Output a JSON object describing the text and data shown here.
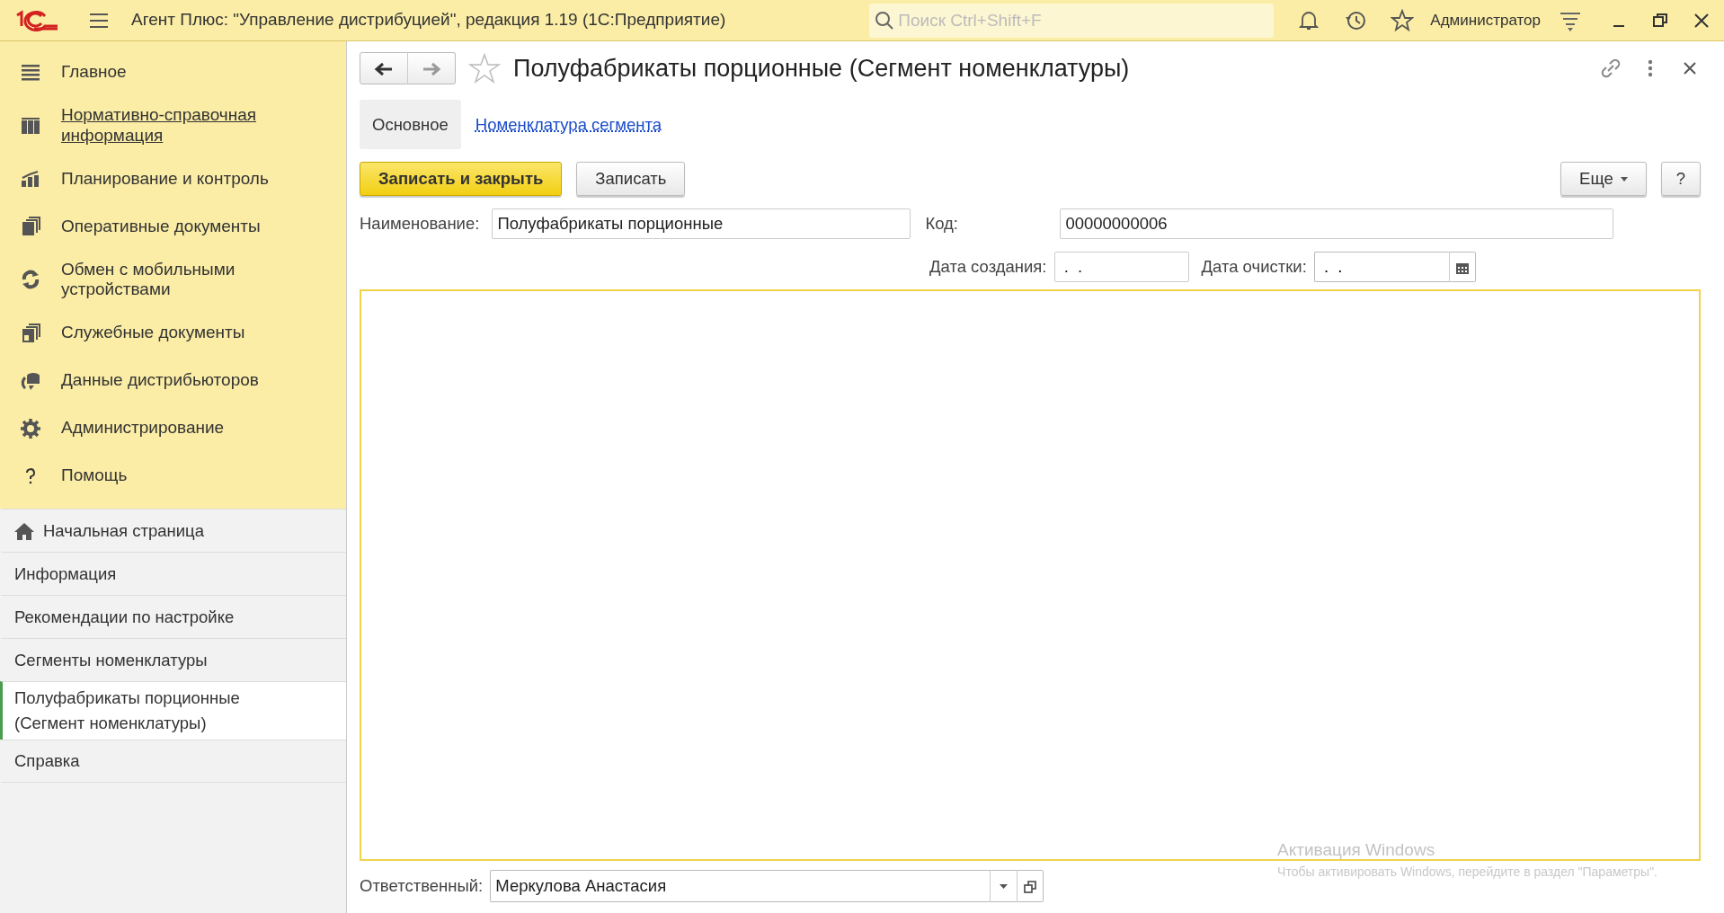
{
  "titlebar": {
    "title": "Агент Плюс: \"Управление дистрибуцией\", редакция 1.19  (1С:Предприятие)",
    "search": {
      "placeholder": "Поиск Ctrl+Shift+F"
    },
    "user": "Администратор"
  },
  "sections": [
    {
      "label": "Главное",
      "hovered": false
    },
    {
      "label": "Нормативно-справочная информация",
      "hovered": true
    },
    {
      "label": "Планирование и контроль",
      "hovered": false
    },
    {
      "label": "Оперативные документы",
      "hovered": false
    },
    {
      "label": "Обмен с мобильными устройствами",
      "hovered": false
    },
    {
      "label": "Служебные документы",
      "hovered": false
    },
    {
      "label": "Данные дистрибьюторов",
      "hovered": false
    },
    {
      "label": "Администрирование",
      "hovered": false
    },
    {
      "label": "Помощь",
      "hovered": false
    }
  ],
  "open_windows": [
    {
      "kind": "home",
      "label": "Начальная страница",
      "selected": false
    },
    {
      "kind": "plain",
      "label": "Информация",
      "selected": false
    },
    {
      "kind": "plain",
      "label": "Рекомендации по настройке",
      "selected": false
    },
    {
      "kind": "plain",
      "label": "Сегменты номенклатуры",
      "selected": false
    },
    {
      "kind": "plain",
      "label": "Полуфабрикаты порционные (Сегмент номенклатуры)",
      "selected": true
    },
    {
      "kind": "plain",
      "label": "Справка",
      "selected": false
    }
  ],
  "form": {
    "title": "Полуфабрикаты порционные (Сегмент номенклатуры)",
    "favorite": false,
    "tabs": [
      {
        "label": "Основное",
        "selected": true
      },
      {
        "label": "Номенклатура сегмента",
        "selected": false
      }
    ],
    "buttons": {
      "save_close": "Записать и закрыть",
      "save": "Записать",
      "more": "Еще",
      "help": "?"
    },
    "name": {
      "label": "Наименование:",
      "value": "Полуфабрикаты порционные"
    },
    "code": {
      "label": "Код:",
      "value": "00000000006"
    },
    "created": {
      "label": "Дата создания:",
      "value": " .  ."
    },
    "cleared": {
      "label": "Дата очистки:",
      "value": " .  ."
    },
    "description": {
      "focused": true
    },
    "responsible": {
      "label": "Ответственный:",
      "value": "Меркулова Анастасия"
    }
  },
  "os_notice": {
    "title": "Активация Windows",
    "text": "Чтобы активировать Windows, перейдите в раздел \"Параметры\"."
  }
}
